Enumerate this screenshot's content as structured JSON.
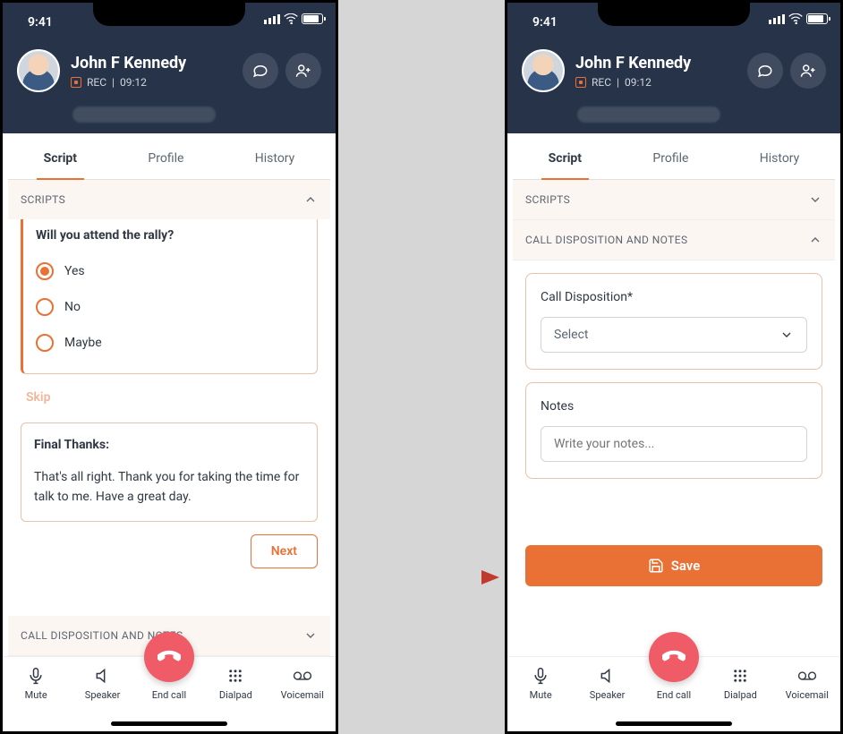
{
  "statusbar": {
    "time": "9:41"
  },
  "caller": {
    "name": "John F Kennedy",
    "rec_label": "REC",
    "timer": "09:12"
  },
  "tabs": {
    "script": "Script",
    "profile": "Profile",
    "history": "History"
  },
  "sections": {
    "scripts": "SCRIPTS",
    "disposition": "CALL DISPOSITION AND NOTES"
  },
  "question": {
    "title": "Will you attend the rally?",
    "options": {
      "yes": "Yes",
      "no": "No",
      "maybe": "Maybe"
    },
    "skip": "Skip"
  },
  "finalthanks": {
    "title": "Final Thanks:",
    "body": "That's all right. Thank you for taking the time for talk to me. Have a great day."
  },
  "buttons": {
    "next": "Next",
    "save": "Save"
  },
  "disposition": {
    "label": "Call Disposition*",
    "select_placeholder": "Select",
    "notes_label": "Notes",
    "notes_placeholder": "Write your notes..."
  },
  "callbar": {
    "mute": "Mute",
    "speaker": "Speaker",
    "endcall": "End call",
    "dialpad": "Dialpad",
    "voicemail": "Voicemail"
  }
}
